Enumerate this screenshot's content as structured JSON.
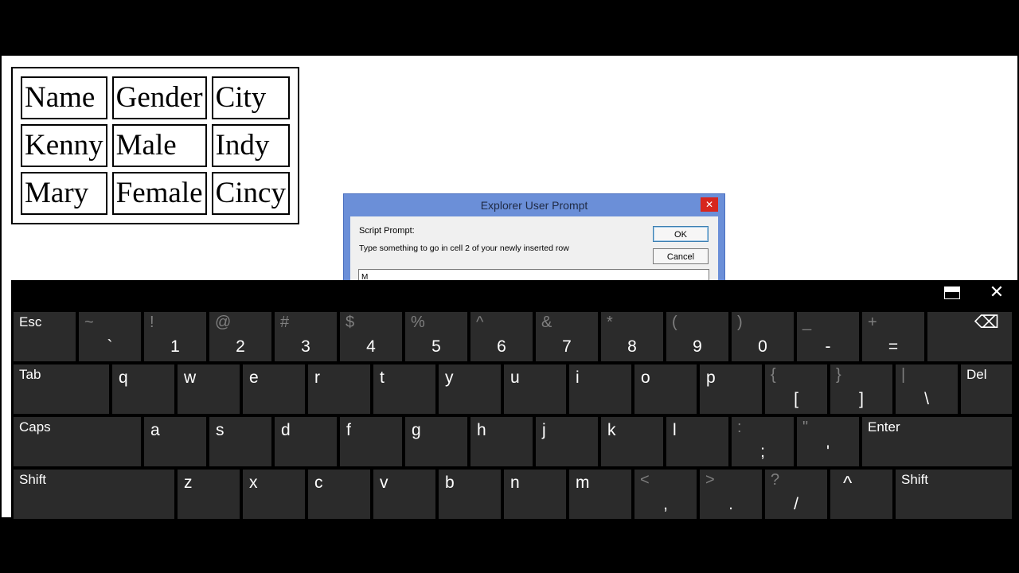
{
  "table": {
    "rows": [
      [
        "Name",
        "Gender",
        "City"
      ],
      [
        "Kenny",
        "Male",
        "Indy"
      ],
      [
        "Mary",
        "Female",
        "Cincy"
      ]
    ]
  },
  "dialog": {
    "title": "Explorer User Prompt",
    "close_symbol": "✕",
    "prompt_label": "Script Prompt:",
    "prompt_text": "Type something to go in cell 2 of your newly inserted row",
    "ok_label": "OK",
    "cancel_label": "Cancel",
    "input_value": "M"
  },
  "keyboard": {
    "close_symbol": "✕",
    "row1": [
      {
        "main": "Esc"
      },
      {
        "sec": "~",
        "main": "`"
      },
      {
        "sec": "!",
        "main": "1"
      },
      {
        "sec": "@",
        "main": "2"
      },
      {
        "sec": "#",
        "main": "3"
      },
      {
        "sec": "$",
        "main": "4"
      },
      {
        "sec": "%",
        "main": "5"
      },
      {
        "sec": "^",
        "main": "6"
      },
      {
        "sec": "&",
        "main": "7"
      },
      {
        "sec": "*",
        "main": "8"
      },
      {
        "sec": "(",
        "main": "9"
      },
      {
        "sec": ")",
        "main": "0"
      },
      {
        "sec": "_",
        "main": "-"
      },
      {
        "sec": "+",
        "main": "="
      },
      {
        "main": "⌫"
      }
    ],
    "row2": [
      {
        "main": "Tab"
      },
      {
        "main": "q"
      },
      {
        "main": "w"
      },
      {
        "main": "e"
      },
      {
        "main": "r"
      },
      {
        "main": "t"
      },
      {
        "main": "y"
      },
      {
        "main": "u"
      },
      {
        "main": "i"
      },
      {
        "main": "o"
      },
      {
        "main": "p"
      },
      {
        "sec": "{",
        "main": "["
      },
      {
        "sec": "}",
        "main": "]"
      },
      {
        "sec": "|",
        "main": "\\"
      },
      {
        "main": "Del"
      }
    ],
    "row3": [
      {
        "main": "Caps"
      },
      {
        "main": "a"
      },
      {
        "main": "s"
      },
      {
        "main": "d"
      },
      {
        "main": "f"
      },
      {
        "main": "g"
      },
      {
        "main": "h"
      },
      {
        "main": "j"
      },
      {
        "main": "k"
      },
      {
        "main": "l"
      },
      {
        "sec": ":",
        "main": ";"
      },
      {
        "sec": "\"",
        "main": "'"
      },
      {
        "main": "Enter"
      }
    ],
    "row4": [
      {
        "main": "Shift"
      },
      {
        "main": "z"
      },
      {
        "main": "x"
      },
      {
        "main": "c"
      },
      {
        "main": "v"
      },
      {
        "main": "b"
      },
      {
        "main": "n"
      },
      {
        "main": "m"
      },
      {
        "sec": "<",
        "main": ","
      },
      {
        "sec": ">",
        "main": "."
      },
      {
        "sec": "?",
        "main": "/"
      },
      {
        "main": "^"
      },
      {
        "main": "Shift"
      }
    ]
  }
}
